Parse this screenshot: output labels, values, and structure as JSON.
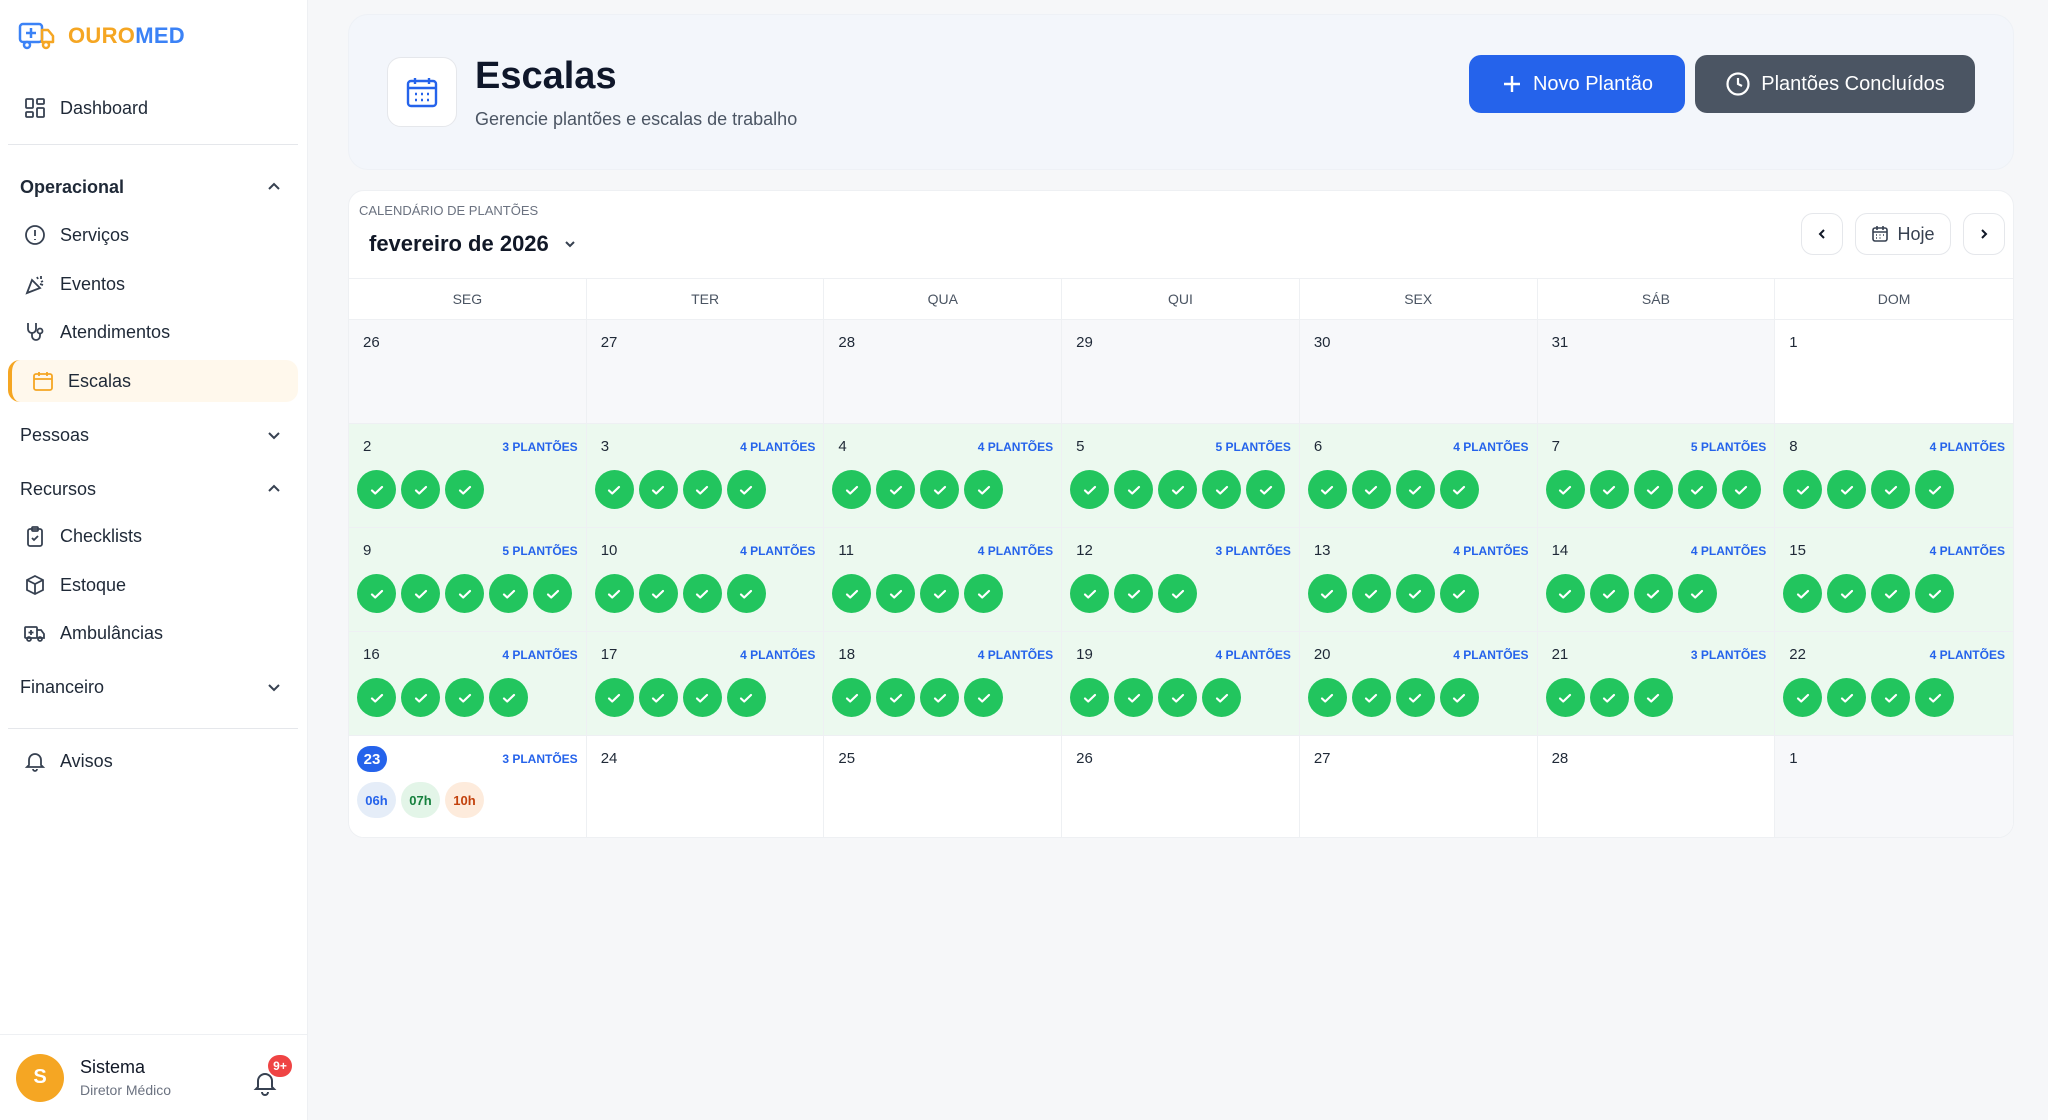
{
  "app": {
    "logo_part1": "OURO",
    "logo_part2": "MED",
    "colors": {
      "accent_orange": "#f5a623",
      "primary_blue": "#2563eb",
      "success_green": "#22c55e",
      "dark_gray": "#4b5563"
    }
  },
  "sidebar": {
    "dashboard": "Dashboard",
    "operacional": "Operacional",
    "servicos": "Serviços",
    "eventos": "Eventos",
    "atendimentos": "Atendimentos",
    "escalas": "Escalas",
    "pessoas": "Pessoas",
    "recursos": "Recursos",
    "checklists": "Checklists",
    "estoque": "Estoque",
    "ambulancias": "Ambulâncias",
    "financeiro": "Financeiro",
    "avisos": "Avisos"
  },
  "user": {
    "initial": "S",
    "name": "Sistema",
    "role": "Diretor Médico",
    "notifications": "9+"
  },
  "header": {
    "title": "Escalas",
    "subtitle": "Gerencie plantões e escalas de trabalho",
    "new_button": "Novo Plantão",
    "done_button": "Plantões Concluídos"
  },
  "calendar": {
    "label": "CALENDÁRIO DE PLANTÕES",
    "month": "fevereiro de 2026",
    "today_button": "Hoje",
    "weekdays": [
      "SEG",
      "TER",
      "QUA",
      "QUI",
      "SEX",
      "SÁB",
      "DOM"
    ],
    "days": [
      {
        "d": "26",
        "k": "dim",
        "n": 0,
        "c": ""
      },
      {
        "d": "27",
        "k": "dim",
        "n": 0,
        "c": ""
      },
      {
        "d": "28",
        "k": "dim",
        "n": 0,
        "c": ""
      },
      {
        "d": "29",
        "k": "dim",
        "n": 0,
        "c": ""
      },
      {
        "d": "30",
        "k": "dim",
        "n": 0,
        "c": ""
      },
      {
        "d": "31",
        "k": "dim",
        "n": 0,
        "c": ""
      },
      {
        "d": "1",
        "k": "white",
        "n": 0,
        "c": ""
      },
      {
        "d": "2",
        "k": "green",
        "n": 3,
        "c": "3 PLANTÕES"
      },
      {
        "d": "3",
        "k": "green",
        "n": 4,
        "c": "4 PLANTÕES"
      },
      {
        "d": "4",
        "k": "green",
        "n": 4,
        "c": "4 PLANTÕES"
      },
      {
        "d": "5",
        "k": "green",
        "n": 5,
        "c": "5 PLANTÕES"
      },
      {
        "d": "6",
        "k": "green",
        "n": 4,
        "c": "4 PLANTÕES"
      },
      {
        "d": "7",
        "k": "green",
        "n": 5,
        "c": "5 PLANTÕES"
      },
      {
        "d": "8",
        "k": "green",
        "n": 4,
        "c": "4 PLANTÕES"
      },
      {
        "d": "9",
        "k": "green",
        "n": 5,
        "c": "5 PLANTÕES"
      },
      {
        "d": "10",
        "k": "green",
        "n": 4,
        "c": "4 PLANTÕES"
      },
      {
        "d": "11",
        "k": "green",
        "n": 4,
        "c": "4 PLANTÕES"
      },
      {
        "d": "12",
        "k": "green",
        "n": 3,
        "c": "3 PLANTÕES"
      },
      {
        "d": "13",
        "k": "green",
        "n": 4,
        "c": "4 PLANTÕES"
      },
      {
        "d": "14",
        "k": "green",
        "n": 4,
        "c": "4 PLANTÕES"
      },
      {
        "d": "15",
        "k": "green",
        "n": 4,
        "c": "4 PLANTÕES"
      },
      {
        "d": "16",
        "k": "green",
        "n": 4,
        "c": "4 PLANTÕES"
      },
      {
        "d": "17",
        "k": "green",
        "n": 4,
        "c": "4 PLANTÕES"
      },
      {
        "d": "18",
        "k": "green",
        "n": 4,
        "c": "4 PLANTÕES"
      },
      {
        "d": "19",
        "k": "green",
        "n": 4,
        "c": "4 PLANTÕES"
      },
      {
        "d": "20",
        "k": "green",
        "n": 4,
        "c": "4 PLANTÕES"
      },
      {
        "d": "21",
        "k": "green",
        "n": 3,
        "c": "3 PLANTÕES"
      },
      {
        "d": "22",
        "k": "green",
        "n": 4,
        "c": "4 PLANTÕES"
      },
      {
        "d": "23",
        "k": "white",
        "n": 0,
        "c": "3 PLANTÕES",
        "today": true,
        "chips": [
          {
            "t": "06h",
            "bg": "#e5edf8",
            "fg": "#2563eb"
          },
          {
            "t": "07h",
            "bg": "#e3f5e8",
            "fg": "#15803d"
          },
          {
            "t": "10h",
            "bg": "#fdebdc",
            "fg": "#c2410c"
          }
        ]
      },
      {
        "d": "24",
        "k": "white",
        "n": 0,
        "c": ""
      },
      {
        "d": "25",
        "k": "white",
        "n": 0,
        "c": ""
      },
      {
        "d": "26",
        "k": "white",
        "n": 0,
        "c": ""
      },
      {
        "d": "27",
        "k": "white",
        "n": 0,
        "c": ""
      },
      {
        "d": "28",
        "k": "white",
        "n": 0,
        "c": ""
      },
      {
        "d": "1",
        "k": "dim",
        "n": 0,
        "c": ""
      }
    ]
  }
}
